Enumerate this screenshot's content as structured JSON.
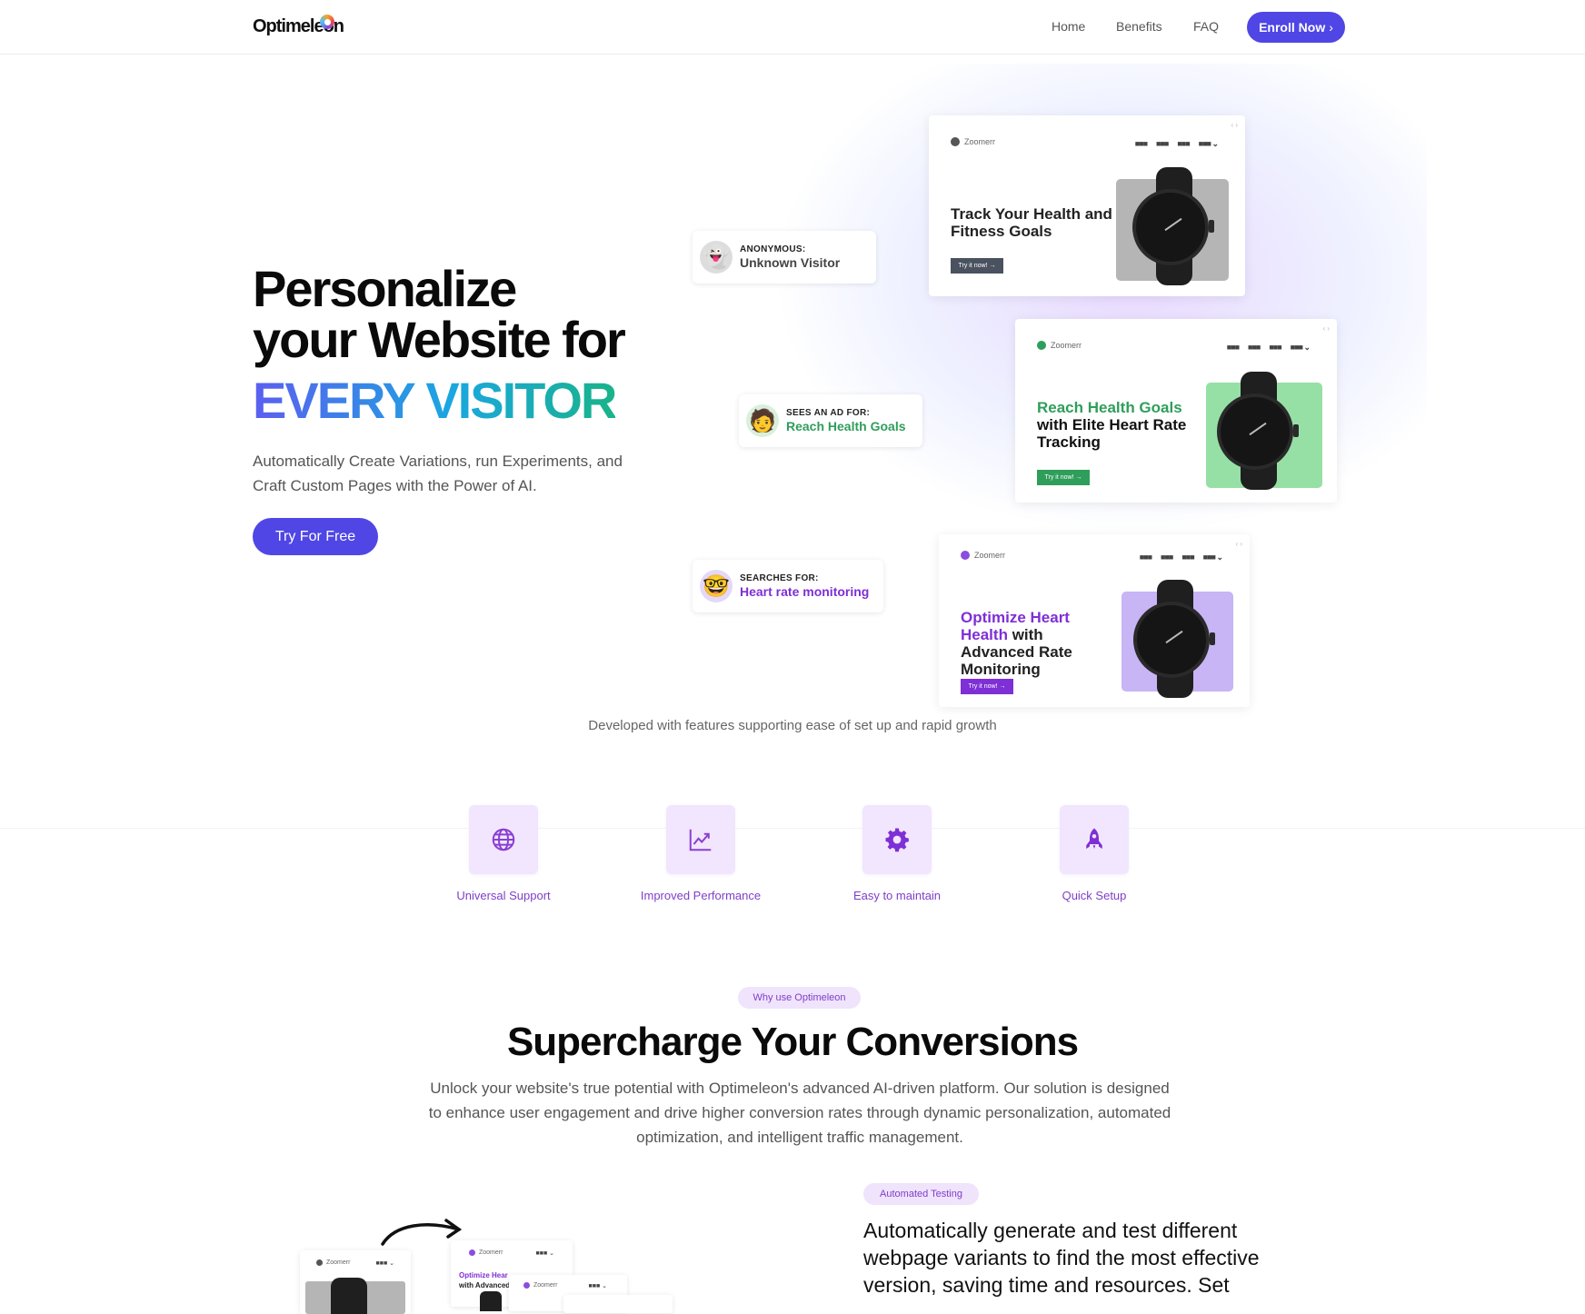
{
  "nav": {
    "logo": "Optimeleon",
    "links": [
      "Home",
      "Benefits",
      "FAQ"
    ],
    "cta": "Enroll Now",
    "cta_icon": "chevron-right-icon"
  },
  "hero": {
    "title_line1": "Personalize",
    "title_line2": "your Website for",
    "title_highlight": "EVERY VISITOR",
    "subtitle": "Automatically Create Variations, run Experiments, and Craft Custom Pages with the Power of AI.",
    "cta": "Try For Free",
    "personas": [
      {
        "label": "ANONYMOUS:",
        "value": "Unknown Visitor",
        "avatar": "ghost-emoji",
        "color": "#444444"
      },
      {
        "label": "SEES AN AD FOR:",
        "value": "Reach Health Goals",
        "avatar": "memoji-curly",
        "color": "#2f9e5b"
      },
      {
        "label": "SEARCHES FOR:",
        "value": "Heart rate monitoring",
        "avatar": "memoji-glasses",
        "color": "#7e2fd6"
      }
    ],
    "mockups": [
      {
        "brand": "Zoomerr",
        "menu": [
          "■■■",
          "■■■",
          "■■■",
          "■■■ ⌄"
        ],
        "title_accent": "",
        "title": "Track Your Health and Fitness Goals",
        "button": "Try it now! →",
        "accent": "#4a5260",
        "image_bg": "#b5b5b5"
      },
      {
        "brand": "Zoomerr",
        "menu": [
          "■■■",
          "■■■",
          "■■■",
          "■■■ ⌄"
        ],
        "title_accent": "Reach Health Goals",
        "title": "with Elite Heart Rate Tracking",
        "button": "Try it now! →",
        "accent": "#2f9e5b",
        "image_bg": "#96e0a6"
      },
      {
        "brand": "Zoomerr",
        "menu": [
          "■■■",
          "■■■",
          "■■■",
          "■■■ ⌄"
        ],
        "title_accent": "Optimize Heart Health",
        "title": "with Advanced Rate Monitoring",
        "button": "Try it now! →",
        "accent": "#7e2fd6",
        "image_bg": "#c7b5f5"
      }
    ],
    "mockup_nav_arrows": "‹ ›"
  },
  "features": {
    "tagline": "Developed with features supporting ease of set up and rapid growth",
    "items": [
      {
        "label": "Universal Support",
        "icon": "globe-icon"
      },
      {
        "label": "Improved Performance",
        "icon": "chart-trend-icon"
      },
      {
        "label": "Easy to maintain",
        "icon": "gear-icon"
      },
      {
        "label": "Quick Setup",
        "icon": "rocket-icon"
      }
    ]
  },
  "why": {
    "pill": "Why use Optimeleon",
    "title": "Supercharge Your Conversions",
    "paragraph": "Unlock your website's true potential with Optimeleon's advanced AI-driven platform. Our solution is designed to enhance user engagement and drive higher conversion rates through dynamic personalization, automated optimization, and intelligent traffic management."
  },
  "automated": {
    "pill": "Automated Testing",
    "text": "Automatically generate and test different webpage variants to find the most effective version, saving time and resources. Set",
    "mini_brand": "Zoomerr",
    "mini_menu": "■■■ ⌄",
    "mini_title_accent": "Optimize Hear",
    "mini_title": "with Advanced"
  }
}
